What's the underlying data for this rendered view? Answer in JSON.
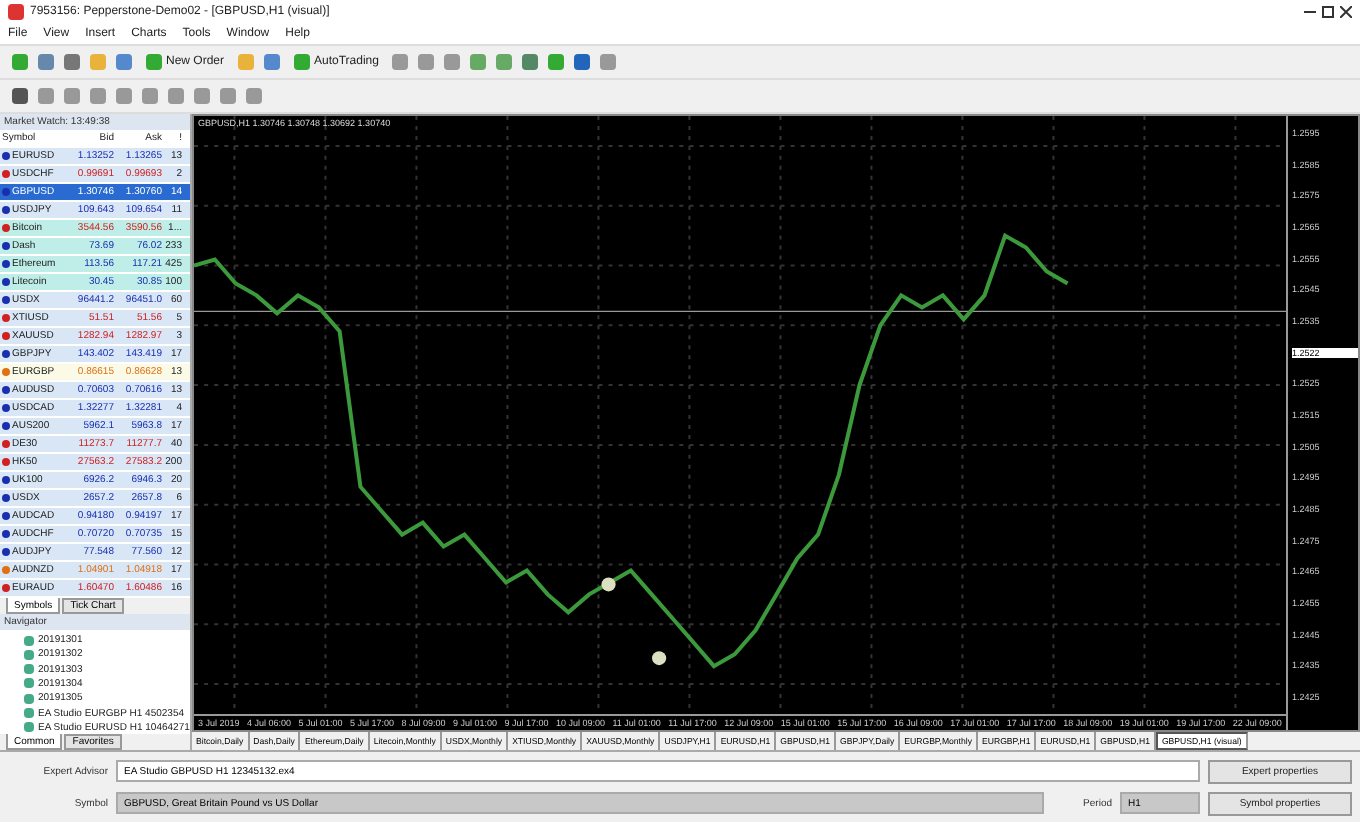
{
  "window": {
    "title": "7953156: Pepperstone-Demo02 - [GBPUSD,H1 (visual)]"
  },
  "menu": [
    "File",
    "View",
    "Insert",
    "Charts",
    "Tools",
    "Window",
    "Help"
  ],
  "toolbar": {
    "new_order": "New Order",
    "auto_trading": "AutoTrading"
  },
  "market_watch": {
    "title": "Market Watch: 13:49:38",
    "columns": [
      "Symbol",
      "Bid",
      "Ask",
      "!"
    ],
    "rows": [
      {
        "symbol": "EURUSD",
        "bid": "1.13252",
        "ask": "1.13265",
        "spread": "13",
        "color": "#1a2fb0",
        "kind": "forex",
        "selected": false
      },
      {
        "symbol": "USDCHF",
        "bid": "0.99691",
        "ask": "0.99693",
        "spread": "2",
        "color": "#d02020",
        "kind": "forex",
        "selected": false
      },
      {
        "symbol": "GBPUSD",
        "bid": "1.30746",
        "ask": "1.30760",
        "spread": "14",
        "color": "#1a2fb0",
        "selected": true
      },
      {
        "symbol": "USDJPY",
        "bid": "109.643",
        "ask": "109.654",
        "spread": "11",
        "color": "#1a2fb0",
        "kind": "forex",
        "selected": false
      },
      {
        "symbol": "Bitcoin",
        "bid": "3544.56",
        "ask": "3590.56",
        "spread": "1...",
        "color": "#d02020",
        "kind": "crypto",
        "selected": false
      },
      {
        "symbol": "Dash",
        "bid": "73.69",
        "ask": "76.02",
        "spread": "233",
        "color": "#1a2fb0",
        "kind": "crypto",
        "selected": false
      },
      {
        "symbol": "Ethereum",
        "bid": "113.56",
        "ask": "117.21",
        "spread": "425",
        "color": "#1a2fb0",
        "kind": "crypto",
        "selected": false
      },
      {
        "symbol": "Litecoin",
        "bid": "30.45",
        "ask": "30.85",
        "spread": "100",
        "color": "#1a2fb0",
        "kind": "crypto",
        "selected": false
      },
      {
        "symbol": "USDX",
        "bid": "96441.2",
        "ask": "96451.0",
        "spread": "60",
        "color": "#1a2fb0",
        "kind": "forex",
        "selected": false
      },
      {
        "symbol": "XTIUSD",
        "bid": "51.51",
        "ask": "51.56",
        "spread": "5",
        "color": "#d02020",
        "kind": "forex",
        "selected": false
      },
      {
        "symbol": "XAUUSD",
        "bid": "1282.94",
        "ask": "1282.97",
        "spread": "3",
        "color": "#d02020",
        "kind": "forex",
        "selected": false
      },
      {
        "symbol": "GBPJPY",
        "bid": "143.402",
        "ask": "143.419",
        "spread": "17",
        "color": "#1a2fb0",
        "kind": "forex",
        "selected": false
      },
      {
        "symbol": "EURGBP",
        "bid": "0.86615",
        "ask": "0.86628",
        "spread": "13",
        "color": "#e07010",
        "kind": "marked",
        "selected": false
      },
      {
        "symbol": "AUDUSD",
        "bid": "0.70603",
        "ask": "0.70616",
        "spread": "13",
        "color": "#1a2fb0",
        "kind": "forex",
        "selected": false
      },
      {
        "symbol": "USDCAD",
        "bid": "1.32277",
        "ask": "1.32281",
        "spread": "4",
        "color": "#1a2fb0",
        "kind": "forex",
        "selected": false
      },
      {
        "symbol": "AUS200",
        "bid": "5962.1",
        "ask": "5963.8",
        "spread": "17",
        "color": "#1a2fb0",
        "kind": "forex",
        "selected": false
      },
      {
        "symbol": "DE30",
        "bid": "11273.7",
        "ask": "11277.7",
        "spread": "40",
        "color": "#d02020",
        "kind": "forex",
        "selected": false
      },
      {
        "symbol": "HK50",
        "bid": "27563.2",
        "ask": "27583.2",
        "spread": "200",
        "color": "#d02020",
        "kind": "forex",
        "selected": false
      },
      {
        "symbol": "UK100",
        "bid": "6926.2",
        "ask": "6946.3",
        "spread": "20",
        "color": "#1a2fb0",
        "kind": "forex",
        "selected": false
      },
      {
        "symbol": "USDX",
        "bid": "2657.2",
        "ask": "2657.8",
        "spread": "6",
        "color": "#1a2fb0",
        "kind": "forex",
        "selected": false
      },
      {
        "symbol": "AUDCAD",
        "bid": "0.94180",
        "ask": "0.94197",
        "spread": "17",
        "color": "#1a2fb0",
        "kind": "forex",
        "selected": false
      },
      {
        "symbol": "AUDCHF",
        "bid": "0.70720",
        "ask": "0.70735",
        "spread": "15",
        "color": "#1a2fb0",
        "kind": "forex",
        "selected": false
      },
      {
        "symbol": "AUDJPY",
        "bid": "77.548",
        "ask": "77.560",
        "spread": "12",
        "color": "#1a2fb0",
        "kind": "forex",
        "selected": false
      },
      {
        "symbol": "AUDNZD",
        "bid": "1.04901",
        "ask": "1.04918",
        "spread": "17",
        "color": "#e07010",
        "kind": "forex",
        "selected": false
      },
      {
        "symbol": "EURAUD",
        "bid": "1.60470",
        "ask": "1.60486",
        "spread": "16",
        "color": "#d02020",
        "kind": "forex",
        "selected": false
      }
    ],
    "tabs": [
      {
        "label": "Symbols",
        "selected": true
      },
      {
        "label": "Tick Chart",
        "selected": false
      }
    ]
  },
  "navigator": {
    "title": "Navigator",
    "items": [
      "20191301",
      "20191302",
      "20191303",
      "20191304",
      "20191305",
      "EA Studio EURGBP H1 4502354",
      "EA Studio EURUSD H1 10464271"
    ],
    "tabs": [
      {
        "label": "Common",
        "selected": true
      },
      {
        "label": "Favorites",
        "selected": false
      }
    ]
  },
  "chart": {
    "label": "GBPUSD,H1  1.30746 1.30748 1.30692 1.30740",
    "prices": [
      "1.2595",
      "1.2585",
      "1.2575",
      "1.2565",
      "1.2555",
      "1.2545",
      "1.2535",
      "1.2525",
      "1.2515",
      "1.2505",
      "1.2495",
      "1.2485",
      "1.2475",
      "1.2465",
      "1.2455",
      "1.2445",
      "1.2435",
      "1.2425"
    ],
    "current_price": "1.2522",
    "times": [
      "3 Jul 2019",
      "4 Jul 06:00",
      "5 Jul 01:00",
      "5 Jul 17:00",
      "8 Jul 09:00",
      "9 Jul 01:00",
      "9 Jul 17:00",
      "10 Jul 09:00",
      "11 Jul 01:00",
      "11 Jul 17:00",
      "12 Jul 09:00",
      "15 Jul 01:00",
      "15 Jul 17:00",
      "16 Jul 09:00",
      "17 Jul 01:00",
      "17 Jul 17:00",
      "18 Jul 09:00",
      "19 Jul 01:00",
      "19 Jul 17:00",
      "22 Jul 09:00"
    ]
  },
  "chart_tabs": [
    {
      "label": "Bitcoin,Daily",
      "selected": false
    },
    {
      "label": "Dash,Daily",
      "selected": false
    },
    {
      "label": "Ethereum,Daily",
      "selected": false
    },
    {
      "label": "Litecoin,Monthly",
      "selected": false
    },
    {
      "label": "USDX,Monthly",
      "selected": false
    },
    {
      "label": "XTIUSD,Monthly",
      "selected": false
    },
    {
      "label": "XAUUSD,Monthly",
      "selected": false
    },
    {
      "label": "USDJPY,H1",
      "selected": false
    },
    {
      "label": "EURUSD,H1",
      "selected": false
    },
    {
      "label": "GBPUSD,H1",
      "selected": false
    },
    {
      "label": "GBPJPY,Daily",
      "selected": false
    },
    {
      "label": "EURGBP,Monthly",
      "selected": false
    },
    {
      "label": "EURGBP,H1",
      "selected": false
    },
    {
      "label": "EURUSD,H1",
      "selected": false
    },
    {
      "label": "GBPUSD,H1",
      "selected": false
    },
    {
      "label": "GBPUSD,H1 (visual)",
      "selected": true
    }
  ],
  "tester": {
    "expert_label": "Expert Advisor",
    "expert_value": "EA Studio GBPUSD H1 12345132.ex4",
    "symbol_label": "Symbol",
    "symbol_value": "GBPUSD, Great Britain Pound vs US Dollar",
    "period_label": "Period",
    "period_value": "H1",
    "buttons": [
      "Expert properties",
      "Symbol properties"
    ]
  }
}
